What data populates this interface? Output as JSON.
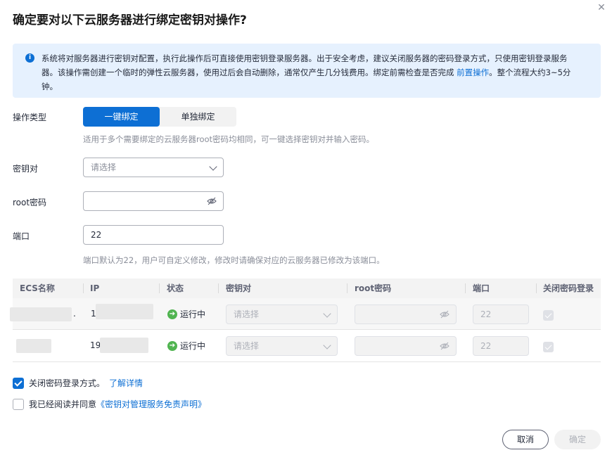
{
  "dialog": {
    "title": "确定要对以下云服务器进行绑定密钥对操作?",
    "close_icon": "close-icon"
  },
  "notice": {
    "text_before_link": "系统将对服务器进行密钥对配置，执行此操作后可直接使用密钥登录服务器。出于安全考虑，建议关闭服务器的密码登录方式，只使用密钥登录服务器。该操作需创建一个临时的弹性云服务器，使用过后会自动删除，通常仅产生几分钱费用。绑定前需检查是否完成 ",
    "link_text": "前置操作",
    "text_after_link": "。整个流程大约3~5分钟。",
    "icon": "info-icon"
  },
  "form": {
    "operation_type_label": "操作类型",
    "options": [
      "一键绑定",
      "单独绑定"
    ],
    "selected_option": "一键绑定",
    "operation_hint": "适用于多个需要绑定的云服务器root密码均相同，可一键选择密钥对并输入密码。",
    "keypair_label": "密钥对",
    "keypair_placeholder": "请选择",
    "root_password_label": "root密码",
    "root_password_value": "",
    "port_label": "端口",
    "port_value": "22",
    "port_hint": "端口默认为22，用户可自定义修改，修改时请确保对应的云服务器已修改为该端口。"
  },
  "table": {
    "headers": [
      "ECS名称",
      "IP",
      "状态",
      "密钥对",
      "root密码",
      "端口",
      "关闭密码登录"
    ],
    "rows": [
      {
        "name_suffix": ".",
        "ip_prefix": "1",
        "status": "运行中",
        "keypair_placeholder": "请选择",
        "port": "22"
      },
      {
        "name_suffix": "",
        "ip_prefix": "19",
        "status": "运行中",
        "keypair_placeholder": "请选择",
        "port": "22"
      }
    ]
  },
  "options_bottom": {
    "disable_password_label": "关闭密码登录方式。",
    "disable_password_link": "了解详情",
    "agree_label": "我已经阅读并同意",
    "agree_link": "《密钥对管理服务免责声明》"
  },
  "buttons": {
    "cancel": "取消",
    "confirm": "确定"
  },
  "colors": {
    "primary": "#0d6fd4",
    "notice_bg": "#e6f1fe",
    "running": "#50b450"
  }
}
